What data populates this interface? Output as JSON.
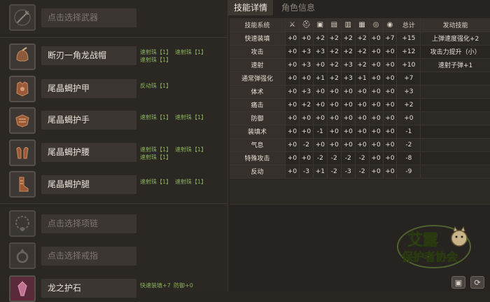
{
  "left": {
    "weapon": {
      "label": "点击选择武器",
      "icon": "weapon-placeholder-icon"
    },
    "head": {
      "label": "断刃一角龙战帽",
      "icon": "helmet-icon",
      "skills": [
        "速射珠【1】",
        "速射珠【1】",
        "速射珠【1】"
      ]
    },
    "chest": {
      "label": "尾晶蝎护甲",
      "icon": "chest-armor-icon",
      "skills": [
        "反动珠【1】"
      ]
    },
    "arms": {
      "label": "尾晶蝎护手",
      "icon": "gauntlet-icon",
      "skills": [
        "速射珠【1】",
        "速射珠【1】"
      ]
    },
    "waist": {
      "label": "尾晶蝎护腰",
      "icon": "waist-armor-icon",
      "skills": [
        "速射珠【1】",
        "速射珠【1】",
        "速射珠【1】"
      ]
    },
    "legs": {
      "label": "尾晶蝎护腿",
      "icon": "leg-armor-icon",
      "skills": [
        "速射珠【1】",
        "速射珠【1】"
      ]
    },
    "necklace": {
      "label": "点击选择项链",
      "icon": "necklace-placeholder-icon"
    },
    "ring": {
      "label": "点击选择戒指",
      "icon": "ring-placeholder-icon"
    },
    "talisman": {
      "label": "龙之护石",
      "icon": "talisman-icon",
      "skills": [
        "快速装填+7",
        "防御+0"
      ]
    }
  },
  "tabs": {
    "active": "技能详情",
    "inactive": "角色信息"
  },
  "table": {
    "header_name": "技能系统",
    "header_icons": [
      "weapon-icon",
      "helmet-icon",
      "chest-armor-icon",
      "gauntlet-icon",
      "waist-armor-icon",
      "leg-armor-icon",
      "necklace-icon",
      "ring-icon"
    ],
    "header_total": "总计",
    "header_activated": "发动技能",
    "rows": [
      {
        "name": "快速装填",
        "values": [
          "+0",
          "+0",
          "+2",
          "+2",
          "+2",
          "+2",
          "+0",
          "+7"
        ],
        "total": "+15",
        "activated": "上弹速度强化+2"
      },
      {
        "name": "攻击",
        "values": [
          "+0",
          "+3",
          "+3",
          "+2",
          "+2",
          "+2",
          "+0",
          "+0"
        ],
        "total": "+12",
        "activated": "攻击力提升（小）"
      },
      {
        "name": "速射",
        "values": [
          "+0",
          "+3",
          "+0",
          "+2",
          "+3",
          "+2",
          "+0",
          "+0"
        ],
        "total": "+10",
        "activated": "速射子弹+1"
      },
      {
        "name": "通常弹强化",
        "values": [
          "+0",
          "+0",
          "+1",
          "+2",
          "+3",
          "+1",
          "+0",
          "+0"
        ],
        "total": "+7",
        "activated": ""
      },
      {
        "name": "体术",
        "values": [
          "+0",
          "+3",
          "+0",
          "+0",
          "+0",
          "+0",
          "+0",
          "+0"
        ],
        "total": "+3",
        "activated": ""
      },
      {
        "name": "痛击",
        "values": [
          "+0",
          "+2",
          "+0",
          "+0",
          "+0",
          "+0",
          "+0",
          "+0"
        ],
        "total": "+2",
        "activated": ""
      },
      {
        "name": "防御",
        "values": [
          "+0",
          "+0",
          "+0",
          "+0",
          "+0",
          "+0",
          "+0",
          "+0"
        ],
        "total": "+0",
        "activated": ""
      },
      {
        "name": "装填术",
        "values": [
          "+0",
          "+0",
          "-1",
          "+0",
          "+0",
          "+0",
          "+0",
          "+0"
        ],
        "total": "-1",
        "activated": ""
      },
      {
        "name": "气息",
        "values": [
          "+0",
          "-2",
          "+0",
          "+0",
          "+0",
          "+0",
          "+0",
          "+0"
        ],
        "total": "-2",
        "activated": ""
      },
      {
        "name": "特殊攻击",
        "values": [
          "+0",
          "+0",
          "-2",
          "-2",
          "-2",
          "-2",
          "+0",
          "+0"
        ],
        "total": "-8",
        "activated": ""
      },
      {
        "name": "反动",
        "values": [
          "+0",
          "-3",
          "+1",
          "-2",
          "-3",
          "-2",
          "+0",
          "+0"
        ],
        "total": "-9",
        "activated": ""
      }
    ]
  },
  "logo": {
    "main": "艾露",
    "sub": "保护者协会"
  },
  "buttons": {
    "save_icon": "save-icon",
    "reset_icon": "refresh-icon"
  }
}
